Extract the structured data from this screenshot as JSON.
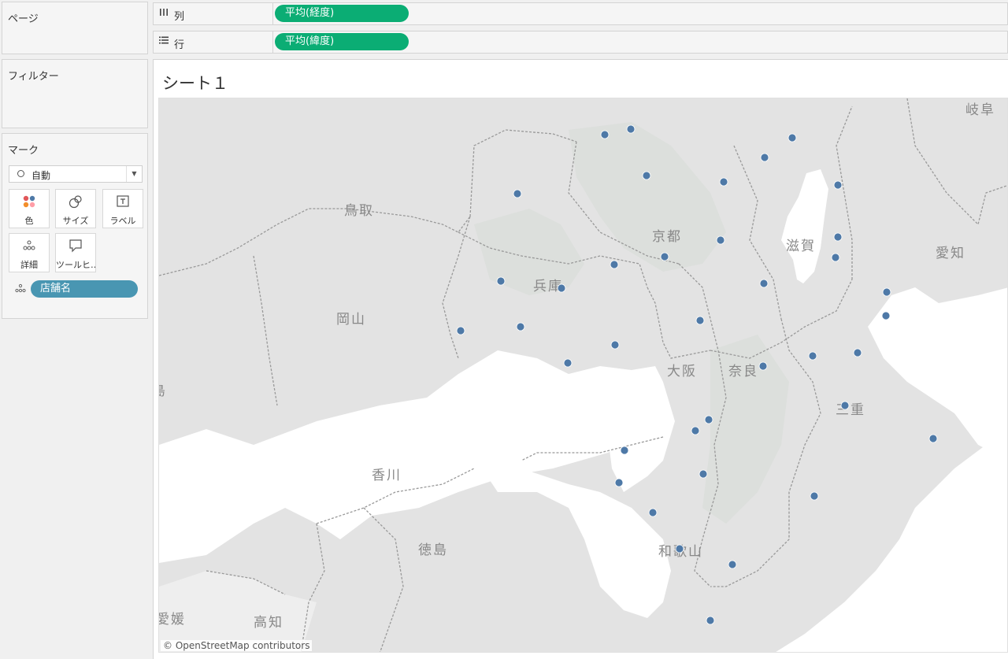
{
  "pages_card": {
    "title": "ページ"
  },
  "filters_card": {
    "title": "フィルター"
  },
  "marks_card": {
    "title": "マーク",
    "mark_type": "自動",
    "buttons": [
      {
        "label": "色",
        "icon": "color-icon"
      },
      {
        "label": "サイズ",
        "icon": "size-icon"
      },
      {
        "label": "ラベル",
        "icon": "label-icon"
      },
      {
        "label": "詳細",
        "icon": "detail-icon"
      },
      {
        "label": "ツールヒ…",
        "icon": "tooltip-icon"
      }
    ],
    "detail_field": "店舗名"
  },
  "shelves": {
    "columns": {
      "label": "列",
      "pill": "平均(経度)"
    },
    "rows": {
      "label": "行",
      "pill": "平均(緯度)"
    }
  },
  "sheet": {
    "title": "シート１"
  },
  "colors": {
    "pill_green": "#0bad74",
    "pill_blue": "#4996b2",
    "mark_blue": "#4e79a7"
  },
  "map": {
    "attribution": "© OpenStreetMap contributors",
    "prefecture_labels": [
      "鳥取",
      "岡山",
      "兵庫",
      "京都",
      "滋賀",
      "大阪",
      "奈良",
      "三重",
      "和歌山",
      "香川",
      "徳島",
      "高知",
      "愛媛",
      "愛知",
      "岐阜",
      "島"
    ],
    "mark_count": 36
  }
}
